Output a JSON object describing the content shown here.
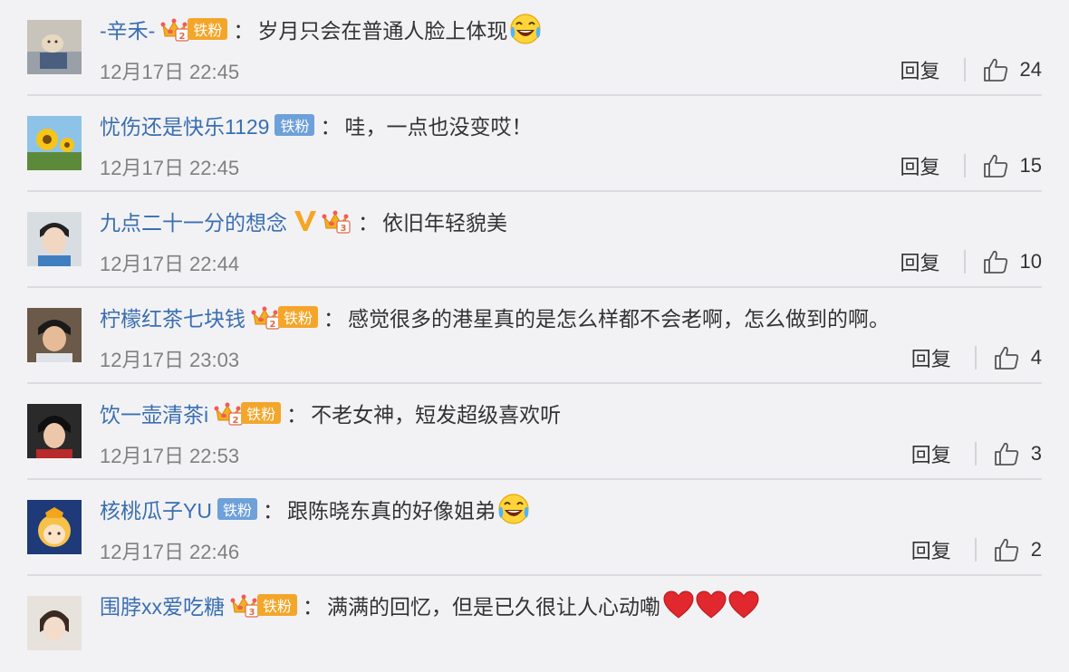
{
  "comments": [
    {
      "user": "-辛禾-",
      "fan_label": "铁粉",
      "text": "岁月只会在普通人脸上体现",
      "emoji": "laugh-cry",
      "time": "12月17日 22:45",
      "reply": "回复",
      "likes": "24"
    },
    {
      "user": "忧伤还是快乐1129",
      "fan_label": "铁粉",
      "text": "哇，一点也没变哎！",
      "time": "12月17日 22:45",
      "reply": "回复",
      "likes": "15"
    },
    {
      "user": "九点二十一分的想念",
      "text": "依旧年轻貌美",
      "time": "12月17日 22:44",
      "reply": "回复",
      "likes": "10"
    },
    {
      "user": "柠檬红茶七块钱",
      "fan_label": "铁粉",
      "text": "感觉很多的港星真的是怎么样都不会老啊，怎么做到的啊。",
      "time": "12月17日 23:03",
      "reply": "回复",
      "likes": "4"
    },
    {
      "user": "饮一壶清茶i",
      "fan_label": "铁粉",
      "text": "不老女神，短发超级喜欢听",
      "time": "12月17日 22:53",
      "reply": "回复",
      "likes": "3"
    },
    {
      "user": "核桃瓜子YU",
      "fan_label": "铁粉",
      "text": "跟陈晓东真的好像姐弟",
      "emoji": "laugh-cry",
      "time": "12月17日 22:46",
      "reply": "回复",
      "likes": "2"
    },
    {
      "user": "围脖xx爱吃糖",
      "fan_label": "铁粉",
      "text": "满满的回忆，但是已久很让人心动嘞",
      "emoji": "red-heart x3"
    }
  ],
  "colors": {
    "username": "#3a6fb0",
    "fan_badge_gold": "#f4a62a",
    "fan_badge_blue": "#6ea0da",
    "timestamp": "#808080",
    "divider": "#dcdce0",
    "background": "#f2f2f5"
  },
  "colon": "："
}
